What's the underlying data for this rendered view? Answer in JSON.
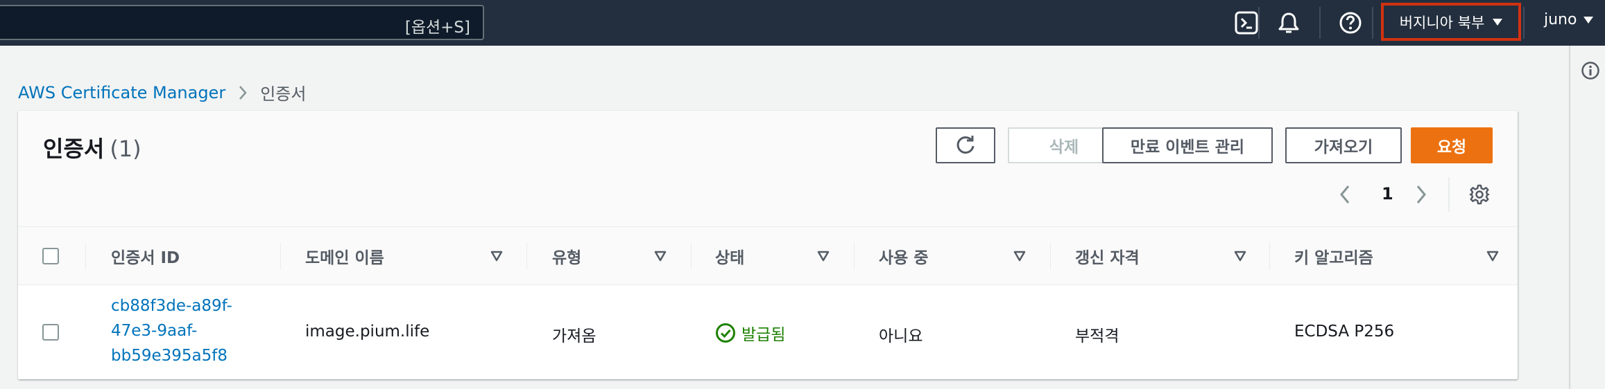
{
  "topbar": {
    "search_shortcut": "[옵션+S]",
    "icons": [
      "cloudshell-icon",
      "bell-icon",
      "help-icon"
    ],
    "region_label": "버지니아 북부",
    "user_label": "juno"
  },
  "breadcrumb": {
    "root": "AWS Certificate Manager",
    "current": "인증서"
  },
  "panel": {
    "title": "인증서",
    "count": "(1)",
    "buttons": {
      "delete": "삭제",
      "manage_expiry": "만료 이벤트 관리",
      "import": "가져오기",
      "request": "요청"
    },
    "pagination": {
      "current_page": "1"
    }
  },
  "table": {
    "columns": [
      "인증서 ID",
      "도메인 이름",
      "유형",
      "상태",
      "사용 중",
      "갱신 자격",
      "키 알고리즘"
    ],
    "rows": [
      {
        "cert_id_lines": [
          "cb88f3de-a89f-",
          "47e3-9aaf-",
          "bb59e395a5f8"
        ],
        "domain": "image.pium.life",
        "type": "가져옴",
        "status": "발급됨",
        "in_use": "아니요",
        "renewal": "부적격",
        "key_algorithm": "ECDSA P256"
      }
    ]
  },
  "colors": {
    "nav_bg": "#232f3e",
    "link": "#0073bb",
    "primary": "#ec7211",
    "success": "#1d8102",
    "highlight_border": "#d13212"
  }
}
